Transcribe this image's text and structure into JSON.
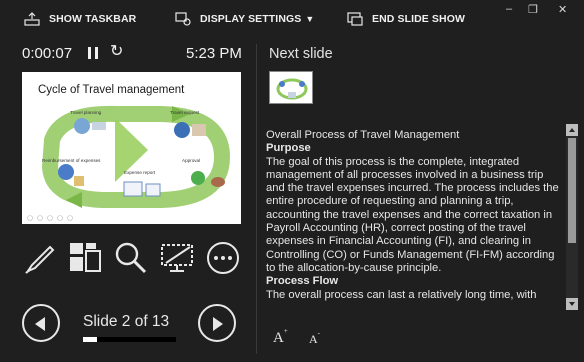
{
  "toolbar": {
    "show_taskbar": "SHOW TASKBAR",
    "display_settings": "DISPLAY SETTINGS",
    "display_settings_caret": "▼",
    "end_slide_show": "END SLIDE SHOW",
    "minimize_glyph": "–",
    "restore_glyph": "❐",
    "close_glyph": "✕"
  },
  "timer": "0:00:07",
  "restart_glyph": "↻",
  "clock": "5:23 PM",
  "current_slide": {
    "title": "Cycle of Travel management",
    "labels": {
      "travel_planning": "Travel planning",
      "travel_request": "Travel request",
      "reimbursement": "Reimbursement of expenses",
      "approval": "Approval",
      "expense_report": "Expense report"
    }
  },
  "tools": [
    {
      "name": "pen-icon"
    },
    {
      "name": "see-all-slides-icon"
    },
    {
      "name": "zoom-icon"
    },
    {
      "name": "black-screen-icon"
    },
    {
      "name": "more-options-icon"
    }
  ],
  "navigation": {
    "counter": "Slide 2 of 13",
    "progress": 0.154
  },
  "next_slide_label": "Next slide",
  "notes": {
    "line1": "Overall Process of Travel Management",
    "heading1": "Purpose",
    "para1": "The goal of this process is the complete, integrated management of all processes involved in a business trip and the travel expenses incurred. The process includes the entire procedure of requesting and planning a trip, accounting the travel expenses and the correct taxation in Payroll Accounting (HR), correct posting of the travel expenses in Financial Accounting (FI), and clearing in Controlling (CO) or Funds Management (FI-FM) according to the allocation-by-cause principle.",
    "heading2": "Process Flow",
    "para2": "The overall process can last a relatively long time, with"
  },
  "font_controls": {
    "increase": "A",
    "decrease": "A",
    "increase_sup": "+",
    "decrease_sup": "-"
  }
}
